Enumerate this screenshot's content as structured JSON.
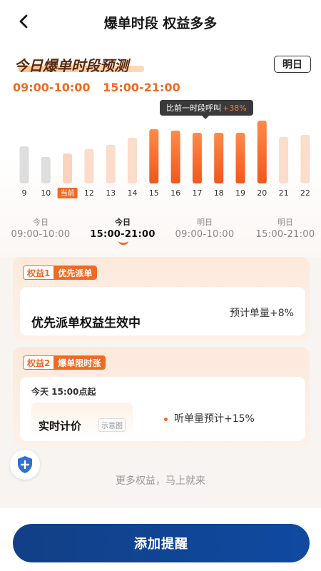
{
  "header": {
    "title": "爆单时段 权益多多"
  },
  "forecast": {
    "title": "今日爆单时段预测",
    "tomorrow_btn": "明日",
    "peak_ranges": [
      "09:00-10:00",
      "15:00-21:00"
    ],
    "tooltip": {
      "text": "比前一时段呼叫",
      "pct": "+38%"
    }
  },
  "chart_data": {
    "type": "bar",
    "categories": [
      "9",
      "10",
      "当前",
      "12",
      "13",
      "14",
      "15",
      "16",
      "17",
      "18",
      "19",
      "20",
      "21",
      "22"
    ],
    "values": [
      52,
      37,
      42,
      48,
      54,
      64,
      76,
      74,
      71,
      71,
      71,
      88,
      65,
      68
    ],
    "bar_states": [
      "past",
      "past",
      "current",
      "future",
      "future",
      "future",
      "peak",
      "peak",
      "peak",
      "peak",
      "peak",
      "peak",
      "future",
      "future"
    ],
    "colors": {
      "past": "#dedede",
      "current": "#fbd2bd",
      "future": "#fcdccb",
      "peak_top": "#ff8a48",
      "peak_bottom": "#f0581c",
      "current_label_bg": "#f06a24"
    }
  },
  "tabs": [
    {
      "day": "今日",
      "range": "09:00-10:00",
      "active": false
    },
    {
      "day": "今日",
      "range": "15:00-21:00",
      "active": true
    },
    {
      "day": "明日",
      "range": "09:00-10:00",
      "active": false
    },
    {
      "day": "明日",
      "range": "15:00-21:00",
      "active": false
    }
  ],
  "benefit1": {
    "num": "权益1",
    "name": "优先派单",
    "text": "优先派单权益生效中",
    "estimate": "预计单量+8%"
  },
  "benefit2": {
    "num": "权益2",
    "name": "爆单限时涨",
    "since": "今天 15:00点起",
    "demo_label": "实时计价",
    "demo_tag": "示意图",
    "estimate": "听单量预计+15%"
  },
  "more_text": "更多权益，马上就来",
  "add_reminder": "添加提醒",
  "icons": {
    "back": "chevron-left-icon",
    "shield": "shield-plus-icon"
  }
}
